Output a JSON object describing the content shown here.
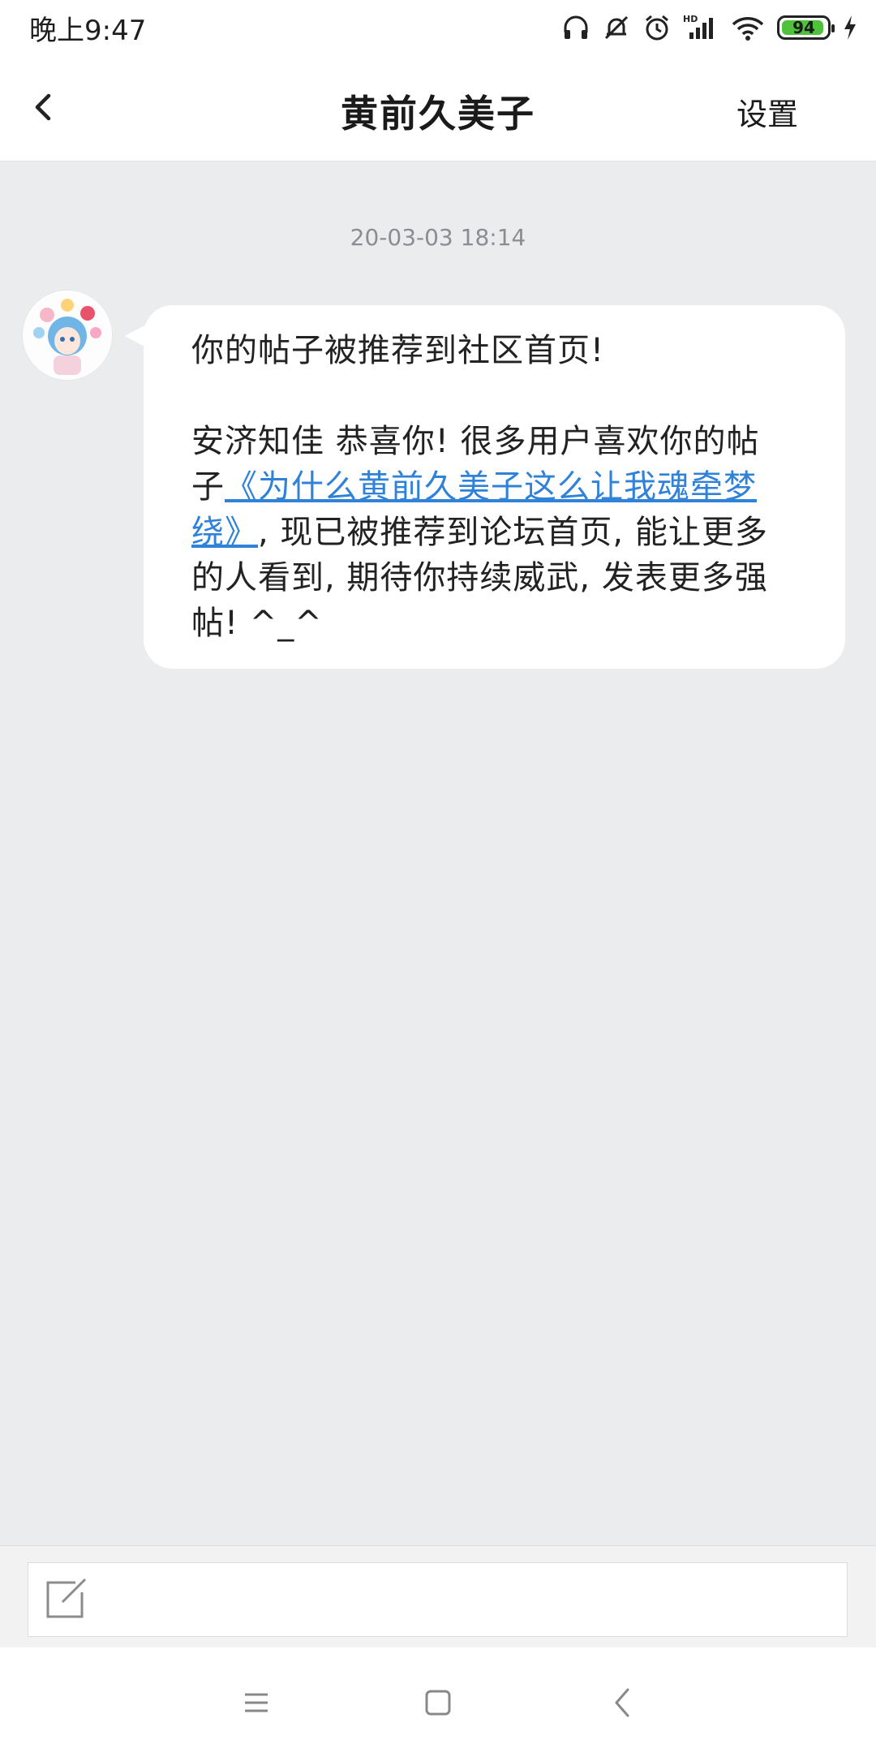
{
  "status_bar": {
    "time": "晚上9:47",
    "battery_level": "94",
    "battery_fraction": 0.94,
    "icons": [
      "headphones-icon",
      "mute-icon",
      "alarm-icon",
      "hd-signal-icon",
      "wifi-icon",
      "battery-icon",
      "charging-icon"
    ],
    "battery_color": "#4fc13c"
  },
  "header": {
    "back_icon": "chevron-left-icon",
    "title": "黄前久美子",
    "settings_label": "设置"
  },
  "conversation": {
    "timestamp": "20-03-03 18:14",
    "message": {
      "line1": "你的帖子被推荐到社区首页!",
      "line2": "安济知佳 恭喜你! 很多用户喜欢你的帖",
      "line3_prefix": "子",
      "link_part1": "《为什么黄前久美子这么让我魂牵梦",
      "link_part2": "绕》",
      "line4_suffix": ", 现已被推荐到论坛首页, 能让更多",
      "line5": "的人看到, 期待你持续威武, 发表更多强",
      "line6": "帖! ^_^",
      "link_color": "#2f82d8"
    }
  },
  "input_bar": {
    "compose_icon": "compose-icon"
  },
  "system_nav": {
    "icons": [
      "menu-icon",
      "home-icon",
      "back-icon"
    ]
  }
}
